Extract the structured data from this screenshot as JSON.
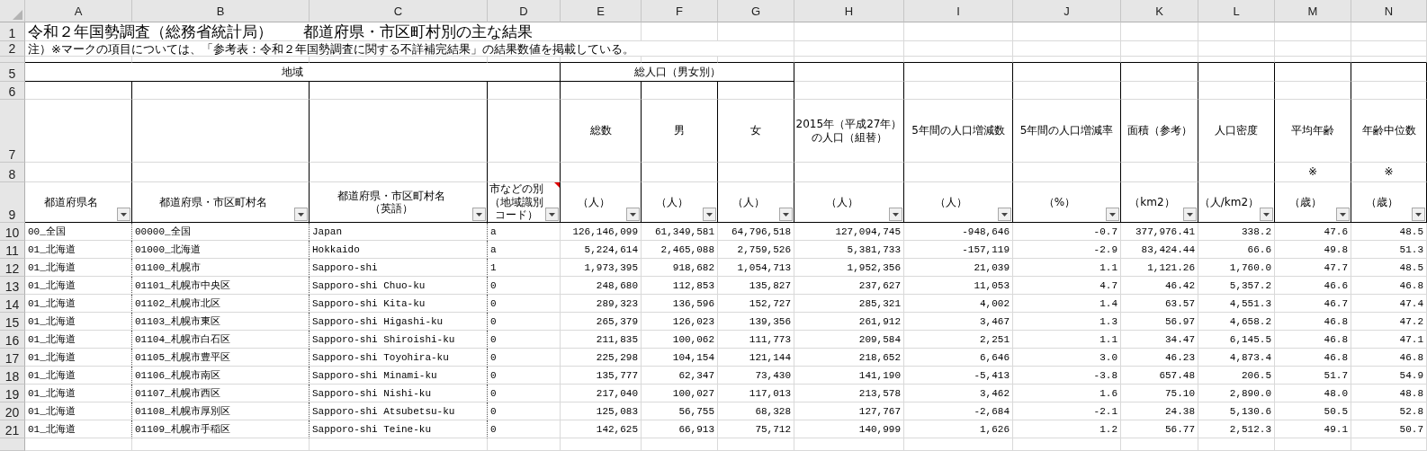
{
  "title": "令和２年国勢調査（総務省統計局）　　都道府県・市区町村別の主な結果",
  "note": "注）※マークの項目については、「参考表：令和２年国勢調査に関する不詳補完結果」の結果数値を掲載している。",
  "column_letters": [
    "A",
    "B",
    "C",
    "D",
    "E",
    "F",
    "G",
    "H",
    "I",
    "J",
    "K",
    "L",
    "M",
    "N"
  ],
  "row_headers": [
    "1",
    "2",
    "5",
    "6",
    "7",
    "8",
    "9"
  ],
  "group_headers": [
    {
      "label": "地域"
    },
    {
      "label": "総人口（男女別）"
    }
  ],
  "columns": [
    {
      "kind": "text",
      "label_lines": [
        "都道府県名"
      ],
      "comment": false
    },
    {
      "kind": "text",
      "label_lines": [
        "都道府県・市区町村名"
      ],
      "comment": false
    },
    {
      "kind": "text",
      "label_lines": [
        "都道府県・市区町村名",
        "（英語）"
      ],
      "comment": false
    },
    {
      "kind": "text",
      "label_lines": [
        "市などの別",
        "（地域識別",
        "コード）"
      ],
      "comment": true
    },
    {
      "kind": "number",
      "label_lines": [
        "総数"
      ],
      "unit": "（人）",
      "comment": false
    },
    {
      "kind": "number",
      "label_lines": [
        "男"
      ],
      "unit": "（人）",
      "comment": false
    },
    {
      "kind": "number",
      "label_lines": [
        "女"
      ],
      "unit": "（人）",
      "comment": false
    },
    {
      "kind": "number",
      "label_lines": [
        "2015年（平成27年）",
        "の人口（組替）"
      ],
      "unit": "（人）",
      "comment": false
    },
    {
      "kind": "number",
      "label_lines": [
        "5年間の人口増減数"
      ],
      "unit": "（人）",
      "comment": false
    },
    {
      "kind": "number",
      "label_lines": [
        "5年間の人口増減率"
      ],
      "unit": "（%）",
      "comment": false
    },
    {
      "kind": "number",
      "label_lines": [
        "面積（参考）"
      ],
      "unit": "（km2）",
      "comment": false
    },
    {
      "kind": "number",
      "label_lines": [
        "人口密度"
      ],
      "unit": "（人/km2）",
      "comment": false
    },
    {
      "kind": "number",
      "label_lines": [
        "平均年齢"
      ],
      "note_mark": "※",
      "unit": "（歳）",
      "comment": false
    },
    {
      "kind": "number",
      "label_lines": [
        "年齢中位数"
      ],
      "note_mark": "※",
      "unit": "（歳）",
      "comment": false
    }
  ],
  "rows": [
    {
      "row": "10",
      "cells": [
        "00_全国",
        "00000_全国",
        "Japan",
        "a",
        "126,146,099",
        "61,349,581",
        "64,796,518",
        "127,094,745",
        "-948,646",
        "-0.7",
        "377,976.41",
        "338.2",
        "47.6",
        "48.5"
      ]
    },
    {
      "row": "11",
      "cells": [
        "01_北海道",
        "01000_北海道",
        "Hokkaido",
        "a",
        "5,224,614",
        "2,465,088",
        "2,759,526",
        "5,381,733",
        "-157,119",
        "-2.9",
        "83,424.44",
        "66.6",
        "49.8",
        "51.3"
      ]
    },
    {
      "row": "12",
      "cells": [
        "01_北海道",
        "01100_札幌市",
        "Sapporo-shi",
        "1",
        "1,973,395",
        "918,682",
        "1,054,713",
        "1,952,356",
        "21,039",
        "1.1",
        "1,121.26",
        "1,760.0",
        "47.7",
        "48.5"
      ]
    },
    {
      "row": "13",
      "cells": [
        "01_北海道",
        "01101_札幌市中央区",
        "Sapporo-shi Chuo-ku",
        "0",
        "248,680",
        "112,853",
        "135,827",
        "237,627",
        "11,053",
        "4.7",
        "46.42",
        "5,357.2",
        "46.6",
        "46.8"
      ]
    },
    {
      "row": "14",
      "cells": [
        "01_北海道",
        "01102_札幌市北区",
        "Sapporo-shi Kita-ku",
        "0",
        "289,323",
        "136,596",
        "152,727",
        "285,321",
        "4,002",
        "1.4",
        "63.57",
        "4,551.3",
        "46.7",
        "47.4"
      ]
    },
    {
      "row": "15",
      "cells": [
        "01_北海道",
        "01103_札幌市東区",
        "Sapporo-shi Higashi-ku",
        "0",
        "265,379",
        "126,023",
        "139,356",
        "261,912",
        "3,467",
        "1.3",
        "56.97",
        "4,658.2",
        "46.8",
        "47.2"
      ]
    },
    {
      "row": "16",
      "cells": [
        "01_北海道",
        "01104_札幌市白石区",
        "Sapporo-shi Shiroishi-ku",
        "0",
        "211,835",
        "100,062",
        "111,773",
        "209,584",
        "2,251",
        "1.1",
        "34.47",
        "6,145.5",
        "46.8",
        "47.1"
      ]
    },
    {
      "row": "17",
      "cells": [
        "01_北海道",
        "01105_札幌市豊平区",
        "Sapporo-shi Toyohira-ku",
        "0",
        "225,298",
        "104,154",
        "121,144",
        "218,652",
        "6,646",
        "3.0",
        "46.23",
        "4,873.4",
        "46.8",
        "46.8"
      ]
    },
    {
      "row": "18",
      "cells": [
        "01_北海道",
        "01106_札幌市南区",
        "Sapporo-shi Minami-ku",
        "0",
        "135,777",
        "62,347",
        "73,430",
        "141,190",
        "-5,413",
        "-3.8",
        "657.48",
        "206.5",
        "51.7",
        "54.9"
      ]
    },
    {
      "row": "19",
      "cells": [
        "01_北海道",
        "01107_札幌市西区",
        "Sapporo-shi Nishi-ku",
        "0",
        "217,040",
        "100,027",
        "117,013",
        "213,578",
        "3,462",
        "1.6",
        "75.10",
        "2,890.0",
        "48.0",
        "48.8"
      ]
    },
    {
      "row": "20",
      "cells": [
        "01_北海道",
        "01108_札幌市厚別区",
        "Sapporo-shi Atsubetsu-ku",
        "0",
        "125,083",
        "56,755",
        "68,328",
        "127,767",
        "-2,684",
        "-2.1",
        "24.38",
        "5,130.6",
        "50.5",
        "52.8"
      ]
    },
    {
      "row": "21",
      "cells": [
        "01_北海道",
        "01109_札幌市手稲区",
        "Sapporo-shi Teine-ku",
        "0",
        "142,625",
        "66,913",
        "75,712",
        "140,999",
        "1,626",
        "1.2",
        "56.77",
        "2,512.3",
        "49.1",
        "50.7"
      ]
    }
  ]
}
